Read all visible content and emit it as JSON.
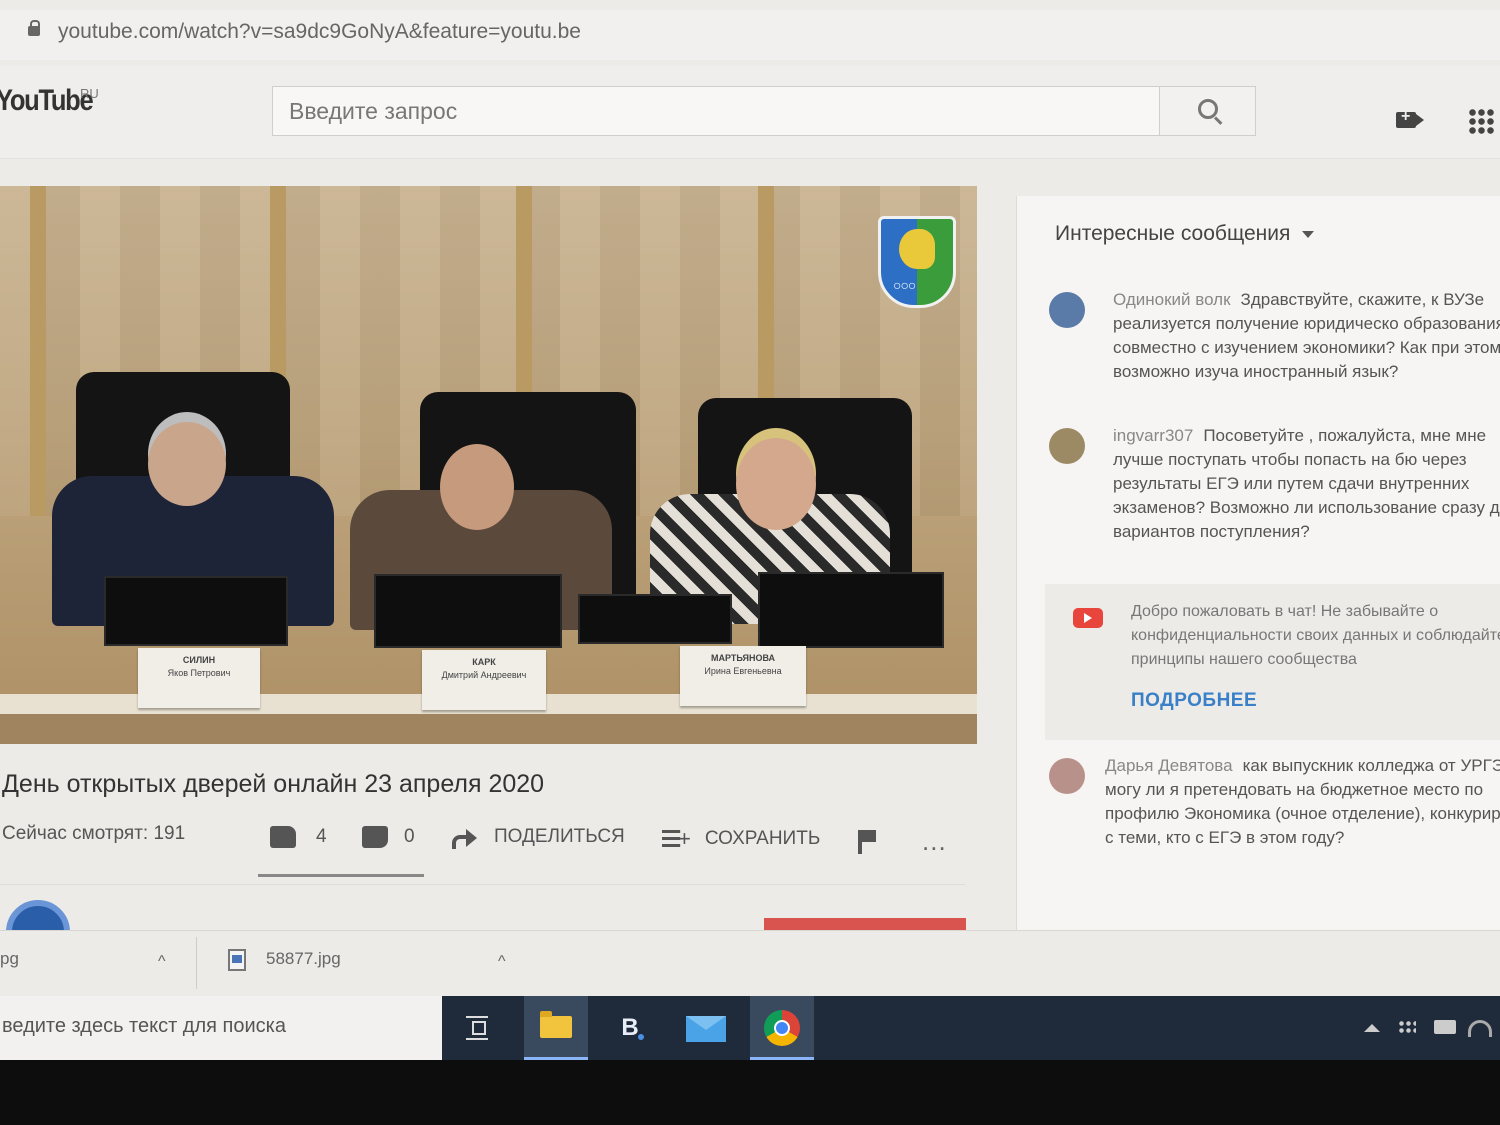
{
  "browser": {
    "url": "youtube.com/watch?v=sa9dc9GoNyA&feature=youtu.be"
  },
  "youtube": {
    "logo": "YouTube",
    "region": "RU",
    "search_placeholder": "Введите запрос"
  },
  "video": {
    "nameplates": [
      {
        "name": "СИЛИН",
        "sub": "Яков Петрович"
      },
      {
        "name": "КАРК",
        "sub": "Дмитрий Андреевич"
      },
      {
        "name": "МАРТЬЯНОВА",
        "sub": "Ирина Евгеньевна"
      }
    ],
    "title": "День открытых дверей онлайн 23 апреля 2020",
    "views": "Сейчас смотрят: 191",
    "likes": "4",
    "dislikes": "0",
    "share_label": "ПОДЕЛИТЬСЯ",
    "save_label": "СОХРАНИТЬ",
    "more_label": "..."
  },
  "chat": {
    "header": "Интересные сообщения",
    "messages": [
      {
        "author": "Одинокий волк",
        "text": "Здравствуйте, скажите, к ВУЗе реализуется получение юридическо образования совместно с изучением экономики? Как при этом возможно изуча иностранный язык?"
      },
      {
        "author": "ingvarr307",
        "text": "Посоветуйте , пожалуйста, мне мне лучше поступать чтобы попасть на бю через результаты ЕГЭ или путем сдачи внутренних экзаменов? Возможно ли использование сразу двух вариантов поступления?"
      },
      {
        "author": "Дарья Девятова",
        "text": "как выпускник колледжа от УРГЭУ) могу ли я претендовать на бюджетное место по профилю Экономика (очное отделение), конкурируя с теми, кто с ЕГЭ в этом году?"
      }
    ],
    "welcome_text": "Добро пожаловать в чат! Не забывайте о конфиденциальности своих данных и соблюдайте принципы нашего сообщества",
    "welcome_link": "ПОДРОБНЕЕ"
  },
  "downloads": {
    "items": [
      {
        "name": "pg"
      },
      {
        "name": "58877.jpg"
      }
    ]
  },
  "taskbar": {
    "search_placeholder": "ведите здесь текст для поиска",
    "vk_label": "B"
  },
  "colors": {
    "link_blue": "#3a80c8",
    "yt_red": "#e8453c",
    "taskbar": "#1f2b3a"
  }
}
